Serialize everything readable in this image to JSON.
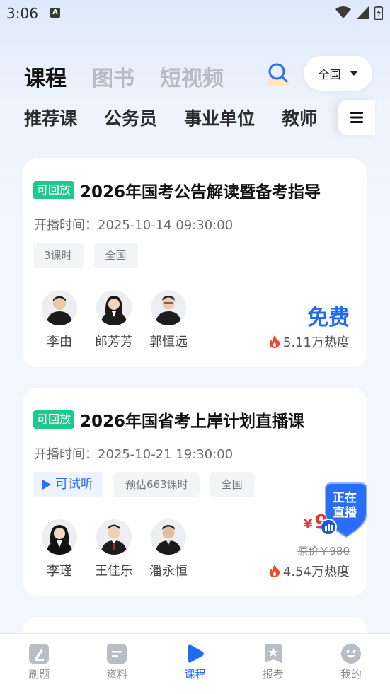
{
  "status_bar": {
    "time": "3:06",
    "notification_letter": "A"
  },
  "header": {
    "tabs": [
      {
        "label": "课程",
        "active": true
      },
      {
        "label": "图书",
        "active": false
      },
      {
        "label": "短视频",
        "active": false
      }
    ],
    "region_label": "全国"
  },
  "categories": [
    "推荐课",
    "公务员",
    "事业单位",
    "教师"
  ],
  "courses": [
    {
      "badge": "可回放",
      "title": "2026年国考公告解读暨备考指导",
      "time": "开播时间：2025-10-14 09:30:00",
      "tags": [
        "3课时",
        "全国"
      ],
      "teachers": [
        "李由",
        "郎芳芳",
        "郭恒远"
      ],
      "price": "免费",
      "heat": "5.11万热度"
    },
    {
      "badge": "可回放",
      "title": "2026年国省考上岸计划直播课",
      "time": "开播时间：2025-10-21 19:30:00",
      "trial_label": "可试听",
      "tags": [
        "预估663课时",
        "全国"
      ],
      "teachers": [
        "李瑾",
        "王佳乐",
        "潘永恒"
      ],
      "price_symbol": "¥",
      "price": "9.9",
      "original_price": "原价￥980",
      "heat": "4.54万热度"
    }
  ],
  "live_badge": {
    "line1": "正在",
    "line2": "直播"
  },
  "bottom_nav": [
    {
      "label": "刷题",
      "icon": "pencil-icon",
      "active": false
    },
    {
      "label": "资料",
      "icon": "document-icon",
      "active": false
    },
    {
      "label": "课程",
      "icon": "play-icon",
      "active": true
    },
    {
      "label": "报考",
      "icon": "bookmark-star-icon",
      "active": false
    },
    {
      "label": "我的",
      "icon": "smiley-icon",
      "active": false
    }
  ],
  "colors": {
    "accent": "#1f6cf2",
    "replay_badge": "#1fc88b",
    "sale_price": "#e8322a"
  }
}
